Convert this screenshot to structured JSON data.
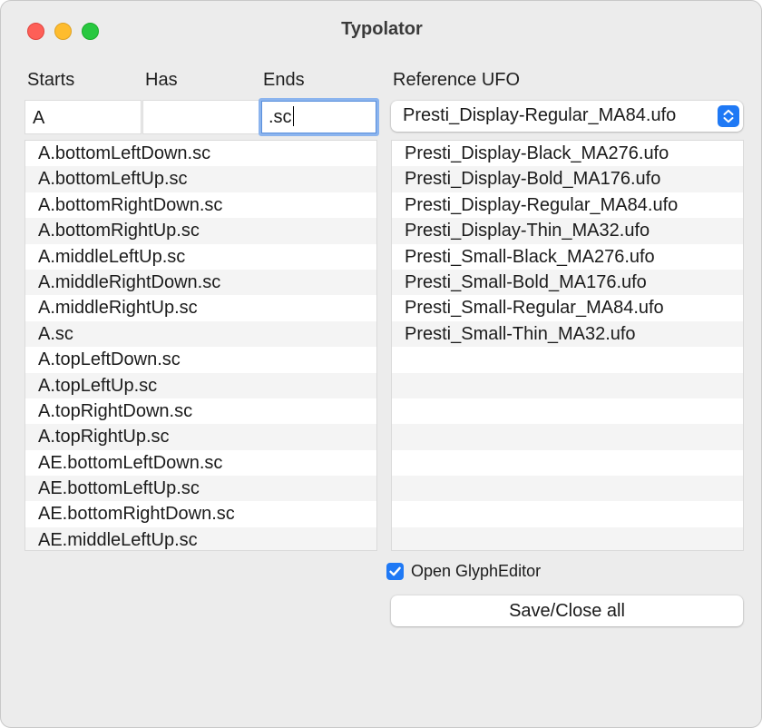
{
  "window": {
    "title": "Typolator"
  },
  "filters": {
    "starts_label": "Starts",
    "has_label": "Has",
    "ends_label": "Ends",
    "starts_value": "A",
    "has_value": "",
    "ends_value": ".sc"
  },
  "reference": {
    "label": "Reference UFO",
    "selected": "Presti_Display-Regular_MA84.ufo"
  },
  "glyphs": [
    "A.bottomLeftDown.sc",
    "A.bottomLeftUp.sc",
    "A.bottomRightDown.sc",
    "A.bottomRightUp.sc",
    "A.middleLeftUp.sc",
    "A.middleRightDown.sc",
    "A.middleRightUp.sc",
    "A.sc",
    "A.topLeftDown.sc",
    "A.topLeftUp.sc",
    "A.topRightDown.sc",
    "A.topRightUp.sc",
    "AE.bottomLeftDown.sc",
    "AE.bottomLeftUp.sc",
    "AE.bottomRightDown.sc",
    "AE.middleLeftUp.sc"
  ],
  "fonts": [
    "Presti_Display-Black_MA276.ufo",
    "Presti_Display-Bold_MA176.ufo",
    "Presti_Display-Regular_MA84.ufo",
    "Presti_Display-Thin_MA32.ufo",
    "Presti_Small-Black_MA276.ufo",
    "Presti_Small-Bold_MA176.ufo",
    "Presti_Small-Regular_MA84.ufo",
    "Presti_Small-Thin_MA32.ufo"
  ],
  "options": {
    "open_glypheditor_label": "Open GlyphEditor",
    "open_glypheditor_checked": true,
    "save_close_label": "Save/Close all"
  },
  "colors": {
    "accent": "#1f79f5",
    "focus_ring": "#8bb4ee",
    "close": "#fe5f57",
    "minimize": "#febc2e",
    "maximize": "#28c840"
  }
}
